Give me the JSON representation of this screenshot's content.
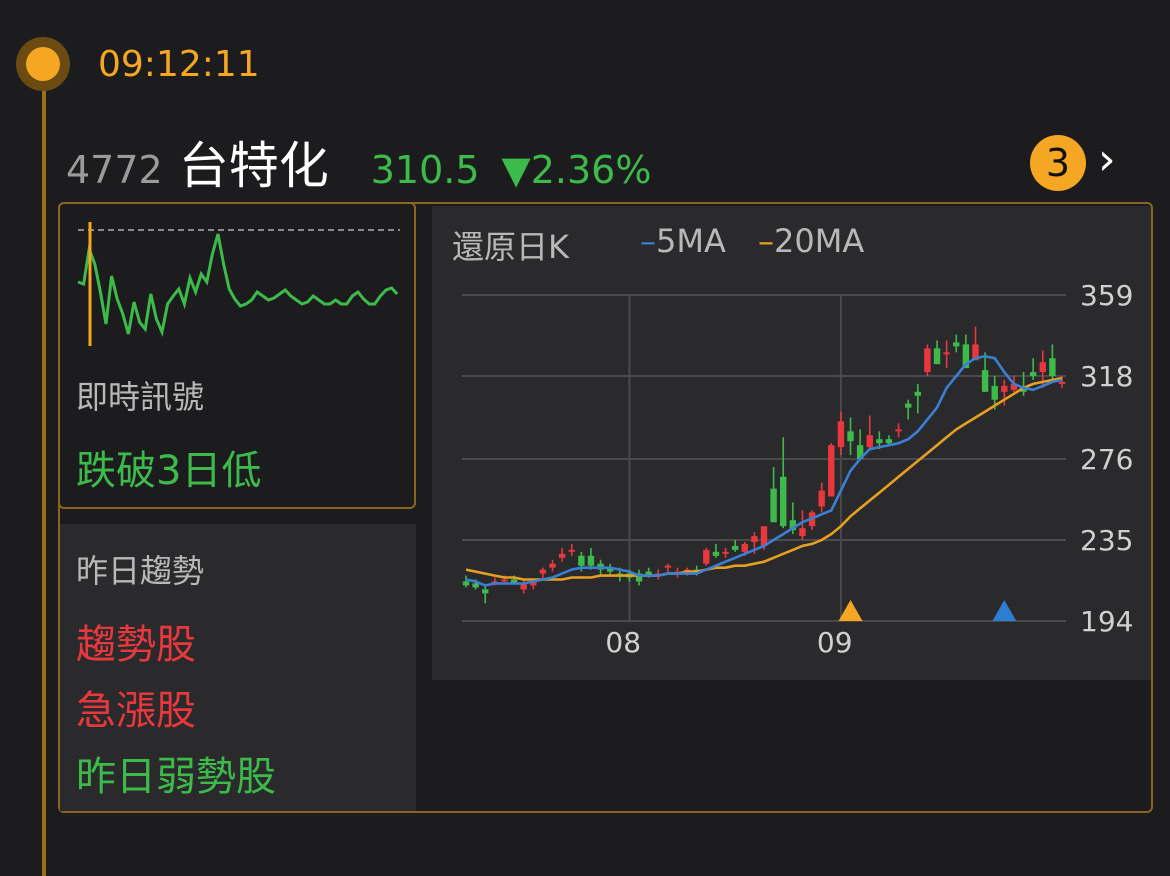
{
  "time": "09:12:11",
  "stock": {
    "code": "4772",
    "name": "台特化",
    "price": "310.5",
    "change": "▼2.36%"
  },
  "notification_count": "3",
  "signal": {
    "label": "即時訊號",
    "value": "跌破3日低"
  },
  "trend": {
    "title": "昨日趨勢",
    "items": [
      {
        "text": "趨勢股",
        "color": "#e8383d"
      },
      {
        "text": "急漲股",
        "color": "#e8383d"
      },
      {
        "text": "昨日弱勢股",
        "color": "#3dbb4a"
      }
    ]
  },
  "chart": {
    "title": "還原日K",
    "legend": [
      {
        "label": "5MA",
        "color": "#3a7fd4"
      },
      {
        "label": "20MA",
        "color": "#e5a022"
      }
    ]
  },
  "colors": {
    "up": "#e8383d",
    "down": "#3dbb4a",
    "accent": "#f5a623"
  },
  "chart_data": {
    "type": "candlestick",
    "title": "還原日K",
    "y_ticks": [
      359,
      318,
      276,
      235,
      194
    ],
    "ylim": [
      194,
      359
    ],
    "x_tick_labels": [
      "08",
      "09"
    ],
    "x_tick_index": [
      17,
      39
    ],
    "markers": [
      {
        "index": 40,
        "color": "#f5a623",
        "shape": "triangle-up"
      },
      {
        "index": 56,
        "color": "#2d7dd2",
        "shape": "triangle-up"
      }
    ],
    "ohlc": [
      [
        214,
        217,
        211,
        212
      ],
      [
        213,
        215,
        210,
        211
      ],
      [
        210,
        212,
        203,
        208
      ],
      [
        213,
        216,
        212,
        214
      ],
      [
        215,
        217,
        213,
        215
      ],
      [
        215,
        217,
        213,
        213
      ],
      [
        210,
        215,
        208,
        213
      ],
      [
        212,
        215,
        210,
        214
      ],
      [
        218,
        221,
        215,
        220
      ],
      [
        221,
        225,
        219,
        223
      ],
      [
        226,
        231,
        224,
        228
      ],
      [
        229,
        233,
        227,
        230
      ],
      [
        227,
        229,
        219,
        222
      ],
      [
        227,
        231,
        220,
        222
      ],
      [
        223,
        225,
        217,
        220
      ],
      [
        221,
        223,
        217,
        219
      ],
      [
        218,
        221,
        214,
        217
      ],
      [
        218,
        220,
        214,
        216
      ],
      [
        218,
        220,
        212,
        214
      ],
      [
        219,
        221,
        216,
        217
      ],
      [
        217,
        220,
        215,
        218
      ],
      [
        221,
        223,
        218,
        222
      ],
      [
        218,
        221,
        216,
        219
      ],
      [
        219,
        221,
        217,
        220
      ],
      [
        220,
        222,
        217,
        218
      ],
      [
        223,
        231,
        222,
        230
      ],
      [
        229,
        233,
        226,
        227
      ],
      [
        228,
        231,
        226,
        229
      ],
      [
        232,
        235,
        229,
        230
      ],
      [
        229,
        234,
        227,
        233
      ],
      [
        234,
        239,
        228,
        237
      ],
      [
        232,
        242,
        230,
        242
      ],
      [
        261,
        272,
        244,
        244
      ],
      [
        267,
        287,
        241,
        242
      ],
      [
        245,
        254,
        238,
        240
      ],
      [
        237,
        250,
        235,
        241
      ],
      [
        242,
        250,
        240,
        249
      ],
      [
        252,
        264,
        249,
        260
      ],
      [
        257,
        284,
        257,
        283
      ],
      [
        282,
        300,
        278,
        295
      ],
      [
        290,
        297,
        278,
        285
      ],
      [
        283,
        291,
        276,
        276
      ],
      [
        282,
        298,
        280,
        288
      ],
      [
        286,
        290,
        281,
        284
      ],
      [
        286,
        288,
        283,
        284
      ],
      [
        290,
        294,
        287,
        291
      ],
      [
        304,
        306,
        296,
        302
      ],
      [
        310,
        314,
        299,
        308
      ],
      [
        320,
        334,
        318,
        332
      ],
      [
        332,
        336,
        324,
        324
      ],
      [
        329,
        336,
        322,
        330
      ],
      [
        335,
        339,
        330,
        333
      ],
      [
        334,
        339,
        325,
        322
      ],
      [
        326,
        343,
        326,
        334
      ],
      [
        321,
        330,
        310,
        310
      ],
      [
        313,
        318,
        301,
        306
      ],
      [
        310,
        316,
        303,
        313
      ],
      [
        311,
        318,
        310,
        314
      ],
      [
        312,
        320,
        308,
        310
      ],
      [
        320,
        327,
        316,
        318
      ],
      [
        320,
        331,
        312,
        325
      ],
      [
        327,
        334,
        316,
        318
      ],
      [
        314,
        318,
        312,
        315
      ]
    ],
    "ma5": [
      215,
      214,
      212,
      213,
      213,
      213,
      213,
      214,
      215,
      216,
      218,
      220,
      221,
      221,
      221,
      221,
      220,
      219,
      217,
      217,
      217,
      218,
      218,
      218,
      218,
      220,
      222,
      224,
      226,
      228,
      230,
      232,
      235,
      238,
      241,
      244,
      246,
      248,
      250,
      260,
      270,
      276,
      281,
      282,
      283,
      284,
      286,
      290,
      296,
      302,
      312,
      318,
      324,
      327,
      328,
      327,
      320,
      314,
      312,
      311,
      313,
      315,
      316
    ],
    "ma20": [
      220,
      219,
      218,
      217,
      216,
      216,
      215,
      215,
      215,
      215,
      215,
      216,
      216,
      216,
      217,
      217,
      217,
      217,
      217,
      217,
      217,
      218,
      218,
      219,
      219,
      220,
      221,
      221,
      222,
      222,
      223,
      224,
      226,
      228,
      230,
      232,
      233,
      235,
      238,
      242,
      247,
      251,
      255,
      259,
      263,
      267,
      271,
      275,
      279,
      283,
      287,
      291,
      294,
      297,
      300,
      303,
      306,
      309,
      312,
      314,
      315,
      316,
      317
    ]
  }
}
